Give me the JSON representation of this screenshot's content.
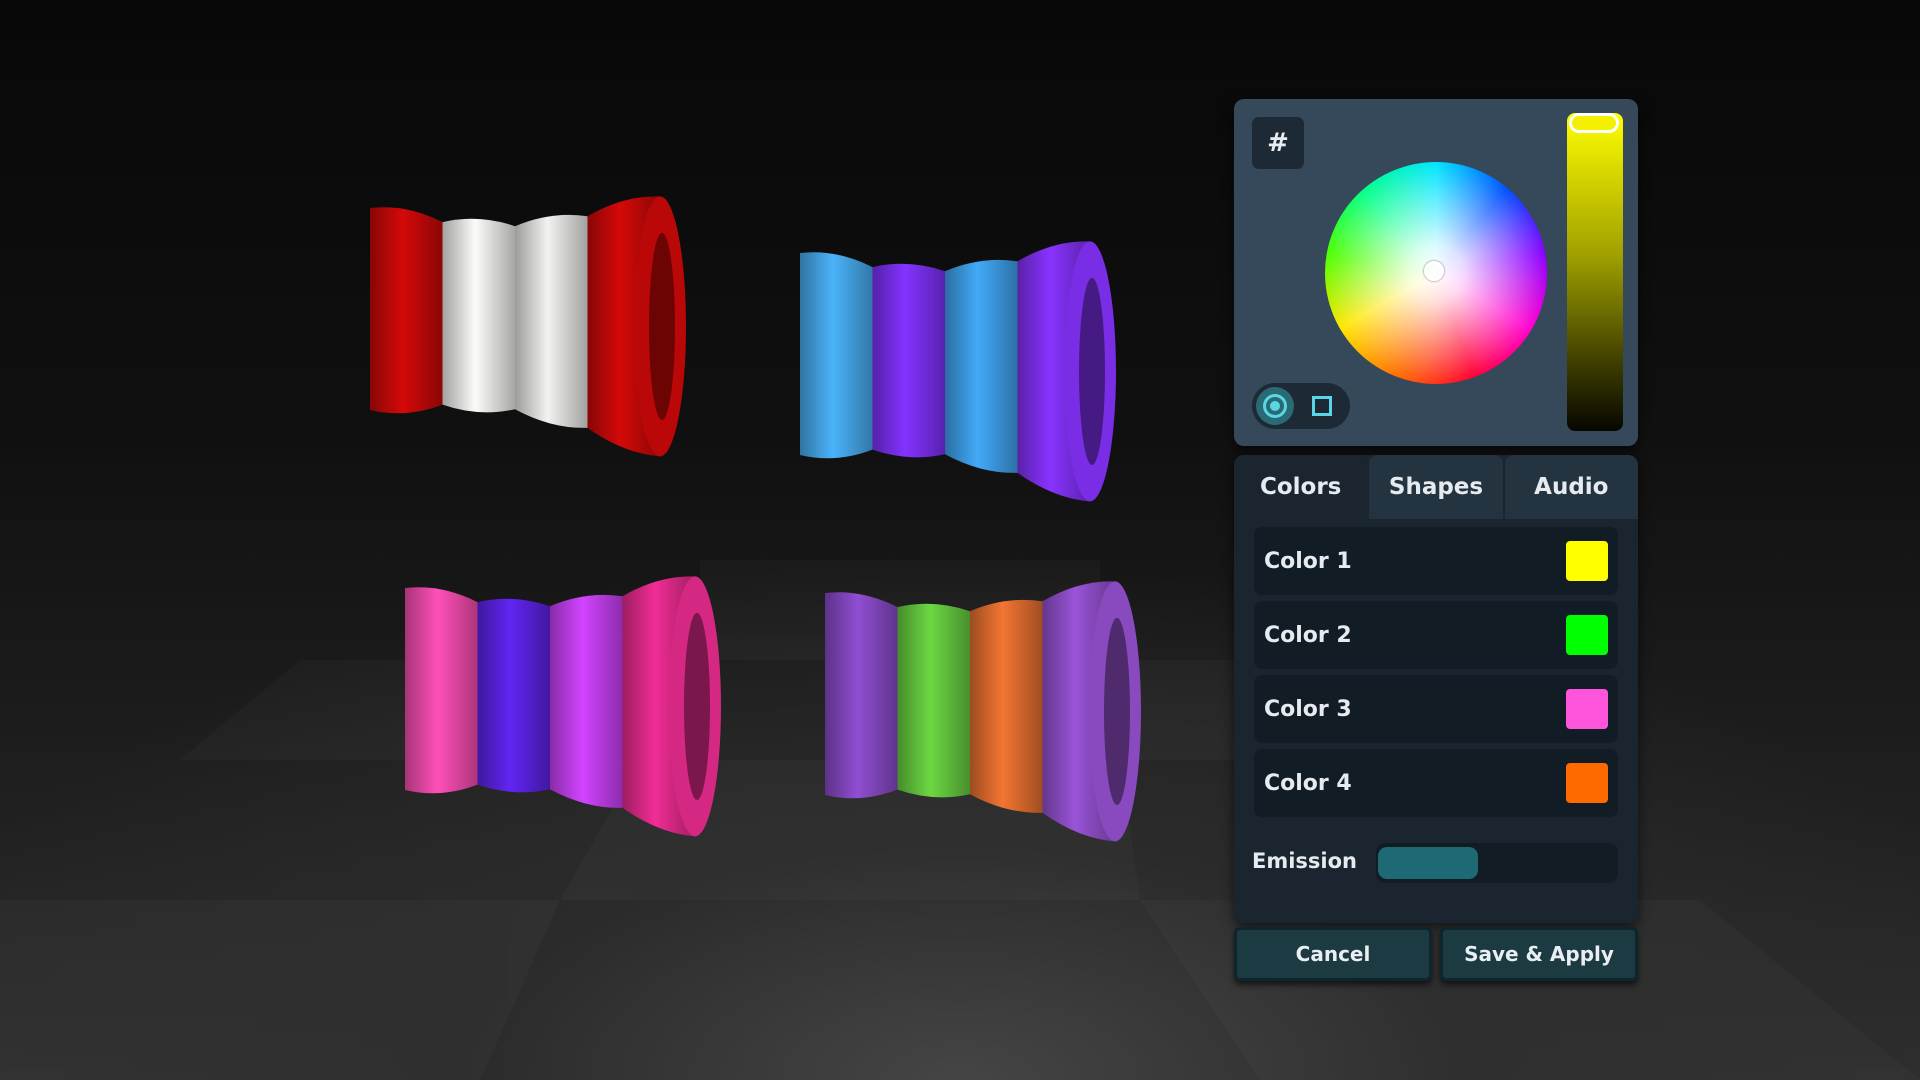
{
  "picker": {
    "hex_button_label": "#",
    "shape_modes": [
      "circle",
      "square"
    ],
    "active_shape_mode": "circle",
    "value_slider_color": "#ffff00",
    "value_level": 1.0
  },
  "tabs": [
    {
      "label": "Colors",
      "active": true
    },
    {
      "label": "Shapes",
      "active": false
    },
    {
      "label": "Audio",
      "active": false
    }
  ],
  "colors": [
    {
      "label": "Color 1",
      "swatch": "#ffff00"
    },
    {
      "label": "Color 2",
      "swatch": "#00ff00"
    },
    {
      "label": "Color 3",
      "swatch": "#ff55dd"
    },
    {
      "label": "Color 4",
      "swatch": "#ff6a00"
    }
  ],
  "emission": {
    "label": "Emission",
    "value": 0.42
  },
  "buttons": {
    "cancel": "Cancel",
    "save_apply": "Save & Apply"
  },
  "objects": [
    {
      "name": "red-white-object",
      "bands": [
        "#c40808",
        "#e8e8e6",
        "#e0e0de",
        "#c40808"
      ]
    },
    {
      "name": "blue-purple-object",
      "bands": [
        "#45a6e8",
        "#7a2ff0",
        "#3d9de6",
        "#7f2ff0"
      ]
    },
    {
      "name": "pink-purple-object",
      "bands": [
        "#f04aaa",
        "#5a22e0",
        "#c23ff0",
        "#e02a8a"
      ]
    },
    {
      "name": "purple-green-orange-object",
      "bands": [
        "#8548c2",
        "#64c83e",
        "#e06c2e",
        "#8f4ec8"
      ]
    }
  ]
}
